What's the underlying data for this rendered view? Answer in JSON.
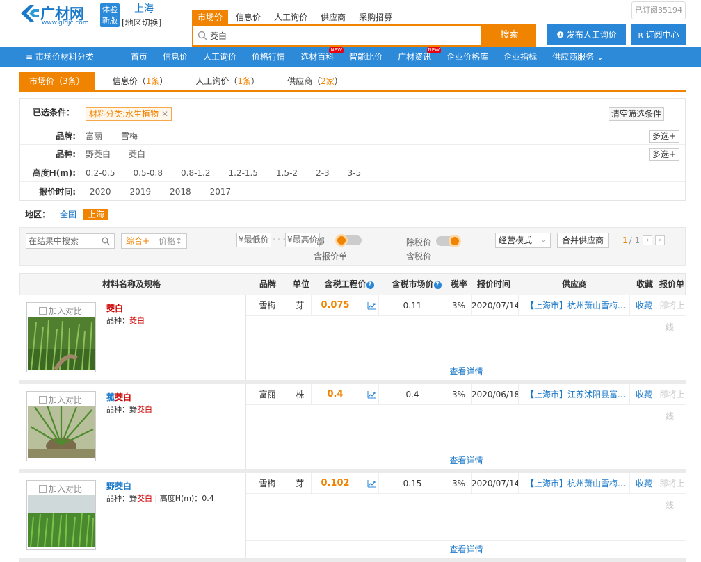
{
  "header": {
    "logo_text": "广材网",
    "logo_url": "www.gldjc.com",
    "logo_badge": "体验新版",
    "city": "上海",
    "city_switch": "[地区切换]",
    "subscribe_count": "已订阅35194",
    "search_tabs": [
      "市场价",
      "信息价",
      "人工询价",
      "供应商",
      "采购招募"
    ],
    "search_value": "茭白",
    "search_button": "搜索",
    "publish_button": "发布人工询价",
    "subscribe_center": "订阅中心"
  },
  "nav": {
    "category_menu": "≡ 市场价材料分类",
    "items": [
      {
        "label": "首页",
        "new": false
      },
      {
        "label": "信息价",
        "new": false
      },
      {
        "label": "人工询价",
        "new": false
      },
      {
        "label": "价格行情",
        "new": false
      },
      {
        "label": "选材百科",
        "new": true
      },
      {
        "label": "智能比价",
        "new": false
      },
      {
        "label": "广材资讯",
        "new": true
      },
      {
        "label": "企业价格库",
        "new": false
      },
      {
        "label": "企业指标",
        "new": false
      },
      {
        "label": "供应商服务",
        "new": false
      }
    ],
    "new_badge_text": "NEW"
  },
  "result_tabs": [
    {
      "label": "市场价",
      "count": "3条"
    },
    {
      "label": "信息价",
      "count": "1条"
    },
    {
      "label": "人工询价",
      "count": "1条"
    },
    {
      "label": "供应商",
      "count": "2家"
    }
  ],
  "filters": {
    "selected_label": "已选条件：",
    "selected_chip": "材料分类:水生植物",
    "clear_button": "清空筛选条件",
    "multi_button": "多选+",
    "brand": {
      "label": "品牌:",
      "options": [
        "富丽",
        "雪梅"
      ]
    },
    "variety": {
      "label": "品种:",
      "options": [
        "野茭白",
        "茭白"
      ]
    },
    "height": {
      "label": "高度H(m):",
      "options": [
        "0.2-0.5",
        "0.5-0.8",
        "0.8-1.2",
        "1.2-1.5",
        "1.5-2",
        "2-3",
        "3-5"
      ]
    },
    "quote_time": {
      "label": "报价时间:",
      "options": [
        "2020",
        "2019",
        "2018",
        "2017"
      ]
    }
  },
  "region": {
    "label": "地区：",
    "options": [
      "全国",
      "上海"
    ],
    "active": "上海"
  },
  "toolbar": {
    "search_placeholder": "在结果中搜索",
    "sort_composite": "综合+",
    "sort_price": "价格↕",
    "min_price": "¥最低价",
    "max_price": "¥最高价",
    "with_quote_partial": "部",
    "with_quote_label": "含报价单",
    "tax_toggle_label": "除税价",
    "tax_included_label": "含税价",
    "mode_select": "经营模式",
    "merge_button": "合并供应商",
    "page_current": "1",
    "page_total": "/ 1"
  },
  "table": {
    "headers": [
      "材料名称及规格",
      "品牌",
      "单位",
      "含税工程价",
      "含税市场价",
      "税率",
      "报价时间",
      "供应商",
      "收藏",
      "报价单"
    ],
    "compare_label": "加入对比",
    "detail_label": "查看详情",
    "fav_label": "收藏",
    "coming_label": "即将上",
    "coming_label2": "线",
    "rows": [
      {
        "name_parts": [
          "茭白"
        ],
        "spec_prefix": "品种：",
        "spec_highlight": "茭白",
        "spec_suffix": "",
        "brand": "雪梅",
        "unit": "芽",
        "eng_price": "0.075",
        "market_price": "0.11",
        "tax": "3%",
        "date": "2020/07/14",
        "supplier": "【上海市】杭州萧山雪梅..."
      },
      {
        "name_parts": [
          "菰",
          "茭白"
        ],
        "spec_prefix": "品种：野",
        "spec_highlight": "茭白",
        "spec_suffix": "",
        "brand": "富丽",
        "unit": "株",
        "eng_price": "0.4",
        "market_price": "0.4",
        "tax": "3%",
        "date": "2020/06/18",
        "supplier": "【上海市】江苏沭阳县富..."
      },
      {
        "name_parts": [
          "野茭白"
        ],
        "spec_prefix": "品种：野",
        "spec_highlight": "茭白",
        "spec_suffix": " | 高度H(m)：0.4",
        "brand": "雪梅",
        "unit": "芽",
        "eng_price": "0.102",
        "market_price": "0.15",
        "tax": "3%",
        "date": "2020/07/14",
        "supplier": "【上海市】杭州萧山雪梅..."
      }
    ]
  },
  "colors": {
    "orange": "#f08300",
    "blue": "#2d8ad9",
    "link": "#1a78c8",
    "red": "#cc0000"
  }
}
